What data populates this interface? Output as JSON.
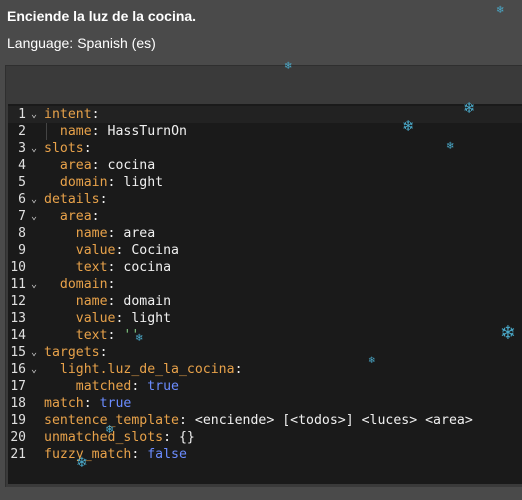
{
  "header": {
    "sentence": "Enciende la luz de la cocina.",
    "language_label": "Language:",
    "language_value": "Spanish (es)"
  },
  "editor": {
    "lines": [
      {
        "n": "1",
        "fold": "⌄",
        "indent": "",
        "key": "intent",
        "sep": ":",
        "val": "",
        "vclass": ""
      },
      {
        "n": "2",
        "fold": "",
        "indent": "  ",
        "key": "name",
        "sep": ": ",
        "val": "HassTurnOn",
        "vclass": "v"
      },
      {
        "n": "3",
        "fold": "⌄",
        "indent": "",
        "key": "slots",
        "sep": ":",
        "val": "",
        "vclass": ""
      },
      {
        "n": "4",
        "fold": "",
        "indent": "  ",
        "key": "area",
        "sep": ": ",
        "val": "cocina",
        "vclass": "v"
      },
      {
        "n": "5",
        "fold": "",
        "indent": "  ",
        "key": "domain",
        "sep": ": ",
        "val": "light",
        "vclass": "v"
      },
      {
        "n": "6",
        "fold": "⌄",
        "indent": "",
        "key": "details",
        "sep": ":",
        "val": "",
        "vclass": ""
      },
      {
        "n": "7",
        "fold": "⌄",
        "indent": "  ",
        "key": "area",
        "sep": ":",
        "val": "",
        "vclass": ""
      },
      {
        "n": "8",
        "fold": "",
        "indent": "    ",
        "key": "name",
        "sep": ": ",
        "val": "area",
        "vclass": "v"
      },
      {
        "n": "9",
        "fold": "",
        "indent": "    ",
        "key": "value",
        "sep": ": ",
        "val": "Cocina",
        "vclass": "v"
      },
      {
        "n": "10",
        "fold": "",
        "indent": "    ",
        "key": "text",
        "sep": ": ",
        "val": "cocina",
        "vclass": "v"
      },
      {
        "n": "11",
        "fold": "⌄",
        "indent": "  ",
        "key": "domain",
        "sep": ":",
        "val": "",
        "vclass": ""
      },
      {
        "n": "12",
        "fold": "",
        "indent": "    ",
        "key": "name",
        "sep": ": ",
        "val": "domain",
        "vclass": "v"
      },
      {
        "n": "13",
        "fold": "",
        "indent": "    ",
        "key": "value",
        "sep": ": ",
        "val": "light",
        "vclass": "v"
      },
      {
        "n": "14",
        "fold": "",
        "indent": "    ",
        "key": "text",
        "sep": ": ",
        "val": "''",
        "vclass": "s"
      },
      {
        "n": "15",
        "fold": "⌄",
        "indent": "",
        "key": "targets",
        "sep": ":",
        "val": "",
        "vclass": ""
      },
      {
        "n": "16",
        "fold": "⌄",
        "indent": "  ",
        "key": "light.luz_de_la_cocina",
        "sep": ":",
        "val": "",
        "vclass": ""
      },
      {
        "n": "17",
        "fold": "",
        "indent": "    ",
        "key": "matched",
        "sep": ": ",
        "val": "true",
        "vclass": "b"
      },
      {
        "n": "18",
        "fold": "",
        "indent": "",
        "key": "match",
        "sep": ": ",
        "val": "true",
        "vclass": "b"
      },
      {
        "n": "19",
        "fold": "",
        "indent": "",
        "key": "sentence_template",
        "sep": ": ",
        "val": "<enciende> [<todos>] <luces> <area>",
        "vclass": "v"
      },
      {
        "n": "20",
        "fold": "",
        "indent": "",
        "key": "unmatched_slots",
        "sep": ": ",
        "val": "{}",
        "vclass": "v"
      },
      {
        "n": "21",
        "fold": "",
        "indent": "",
        "key": "fuzzy_match",
        "sep": ": ",
        "val": "false",
        "vclass": "b"
      }
    ]
  },
  "colors": {
    "key": "#e8a24a",
    "boolean": "#6b8cff",
    "string": "#7ec27e",
    "snowflake": "#4aa9c9"
  },
  "decorations": {
    "snowflake_glyph": "❄"
  }
}
